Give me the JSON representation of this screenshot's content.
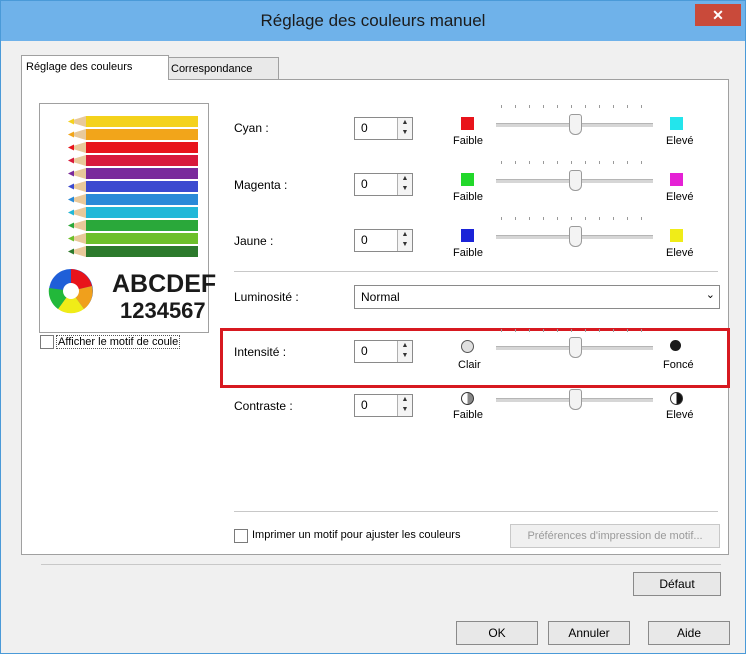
{
  "window": {
    "title": "Réglage des couleurs manuel",
    "close_label": "✕"
  },
  "tabs": [
    {
      "label": "Réglage des couleurs",
      "active": true
    },
    {
      "label": "Correspondance",
      "active": false
    }
  ],
  "preview": {
    "text_letters": "ABCDEF",
    "text_numbers": "1234567"
  },
  "show_pattern": {
    "label": "Afficher le motif de coule",
    "checked": false
  },
  "colors": {
    "cyan": {
      "label": "Cyan :",
      "value": "0",
      "low_label": "Faible",
      "high_label": "Elevé",
      "low_color": "#e8141b",
      "high_color": "#23e5ec",
      "level": 0.5
    },
    "magenta": {
      "label": "Magenta :",
      "value": "0",
      "low_label": "Faible",
      "high_label": "Elevé",
      "low_color": "#22d82a",
      "high_color": "#e521d5",
      "level": 0.5
    },
    "jaune": {
      "label": "Jaune :",
      "value": "0",
      "low_label": "Faible",
      "high_label": "Elevé",
      "low_color": "#1a23d8",
      "high_color": "#f0ec18",
      "level": 0.5
    }
  },
  "luminosite": {
    "label": "Luminosité :",
    "selected": "Normal"
  },
  "intensite": {
    "label": "Intensité :",
    "value": "0",
    "low_label": "Clair",
    "high_label": "Foncé",
    "level": 0.5
  },
  "contraste": {
    "label": "Contraste :",
    "value": "0",
    "low_label": "Faible",
    "high_label": "Elevé",
    "level": 0.5
  },
  "print_pattern": {
    "label": "Imprimer un motif pour ajuster les couleurs",
    "checked": false
  },
  "pattern_prefs_button": "Préférences d'impression de motif...",
  "default_button": "Défaut",
  "ok_button": "OK",
  "cancel_button": "Annuler",
  "help_button": "Aide"
}
